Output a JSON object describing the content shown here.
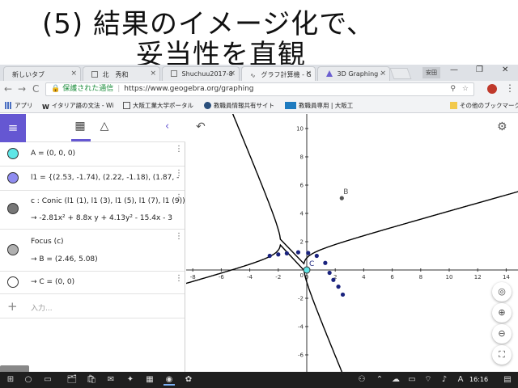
{
  "slide": {
    "title_line1": "(5) 結果のイメージ化で、",
    "title_line2": "妥当性を直観"
  },
  "browser": {
    "tabs": [
      {
        "label": "新しいタブ",
        "close": "×"
      },
      {
        "label": "北　秀和",
        "close": "×"
      },
      {
        "label": "Shuchuu2017-8",
        "close": "×"
      },
      {
        "label": "グラフ計算機 - G",
        "close": "×"
      },
      {
        "label": "3D Graphing -",
        "close": "×"
      }
    ],
    "profile": "安田",
    "window_controls": {
      "minimize": "—",
      "maximize": "❐",
      "close": "✕"
    },
    "nav": {
      "back": "←",
      "forward": "→",
      "reload": "C"
    },
    "secure_label": "保護された通信",
    "url": "https://www.geogebra.org/graphing",
    "bookmarks": [
      {
        "label": "アプリ"
      },
      {
        "label": "イタリア語の文法 - Wi"
      },
      {
        "label": "大阪工業大学ポータル"
      },
      {
        "label": "教職員情報共有サイト"
      },
      {
        "label": "教職員専用 | 大阪工"
      },
      {
        "label": "その他のブックマーク"
      }
    ]
  },
  "ggb": {
    "menu_icon": "≡",
    "algebra_tab_icon": "▦",
    "tools_tab_icon": "△",
    "collapse_icon": "‹",
    "rows": [
      {
        "text": "A = (0, 0, 0)"
      },
      {
        "text": "l1 = {(2.53, -1.74), (2.22, -1.18), (1.87, -"
      },
      {
        "text": "c : Conic (l1 (1), l1 (3), l1 (5), l1 (7), l1 (9))",
        "sub": "→  -2.81x² + 8.8x y + 4.13y² - 15.4x - 3"
      },
      {
        "text": "Focus (c)",
        "sub": "→  B = (2.46, 5.08)"
      },
      {
        "text": "→  C = (0, 0)"
      }
    ],
    "input_placeholder": "入力...",
    "kebab": "⋮",
    "plus": "+",
    "undo_icon": "↶",
    "gear_icon": "⚙",
    "zoom_buttons": {
      "home": "◎",
      "zoom_in": "⊕",
      "zoom_out": "⊖",
      "fullscreen": "⛶"
    },
    "point_labels": {
      "B": "B",
      "C": "C"
    }
  },
  "chart_data": {
    "type": "line",
    "xlim": [
      -9,
      15
    ],
    "ylim": [
      -7,
      10.5
    ],
    "x_ticks": [
      -8,
      -6,
      -4,
      -2,
      0,
      2,
      4,
      6,
      8,
      10,
      12,
      14
    ],
    "y_ticks": [
      -6,
      -4,
      -2,
      2,
      4,
      6,
      8,
      10
    ],
    "grid": false,
    "conic": {
      "a": -2.81,
      "b": 8.8,
      "c": 4.13,
      "d": -15.4,
      "e": -3
    },
    "points_l1": [
      [
        -2.6,
        1.0
      ],
      [
        -2.0,
        1.1
      ],
      [
        -1.4,
        1.18
      ],
      [
        -0.6,
        1.25
      ],
      [
        0.1,
        1.2
      ],
      [
        0.7,
        1.0
      ],
      [
        1.3,
        0.5
      ],
      [
        1.6,
        -0.2
      ],
      [
        1.87,
        -0.7
      ],
      [
        2.22,
        -1.18
      ],
      [
        2.53,
        -1.74
      ]
    ],
    "point_B": [
      2.46,
      5.08
    ],
    "point_C": [
      0,
      0
    ],
    "colors": {
      "curve": "#000000",
      "points": "#1a237e",
      "point_C": "#5ee6e6",
      "point_B": "#555555",
      "axis": "#333333"
    }
  },
  "taskbar": {
    "start": "⊞",
    "search": "○",
    "task_view": "▭",
    "apps": [
      "🗂",
      "🛍",
      "✉",
      "✦",
      "▦",
      "◉",
      "✿"
    ],
    "time": "16:16"
  }
}
